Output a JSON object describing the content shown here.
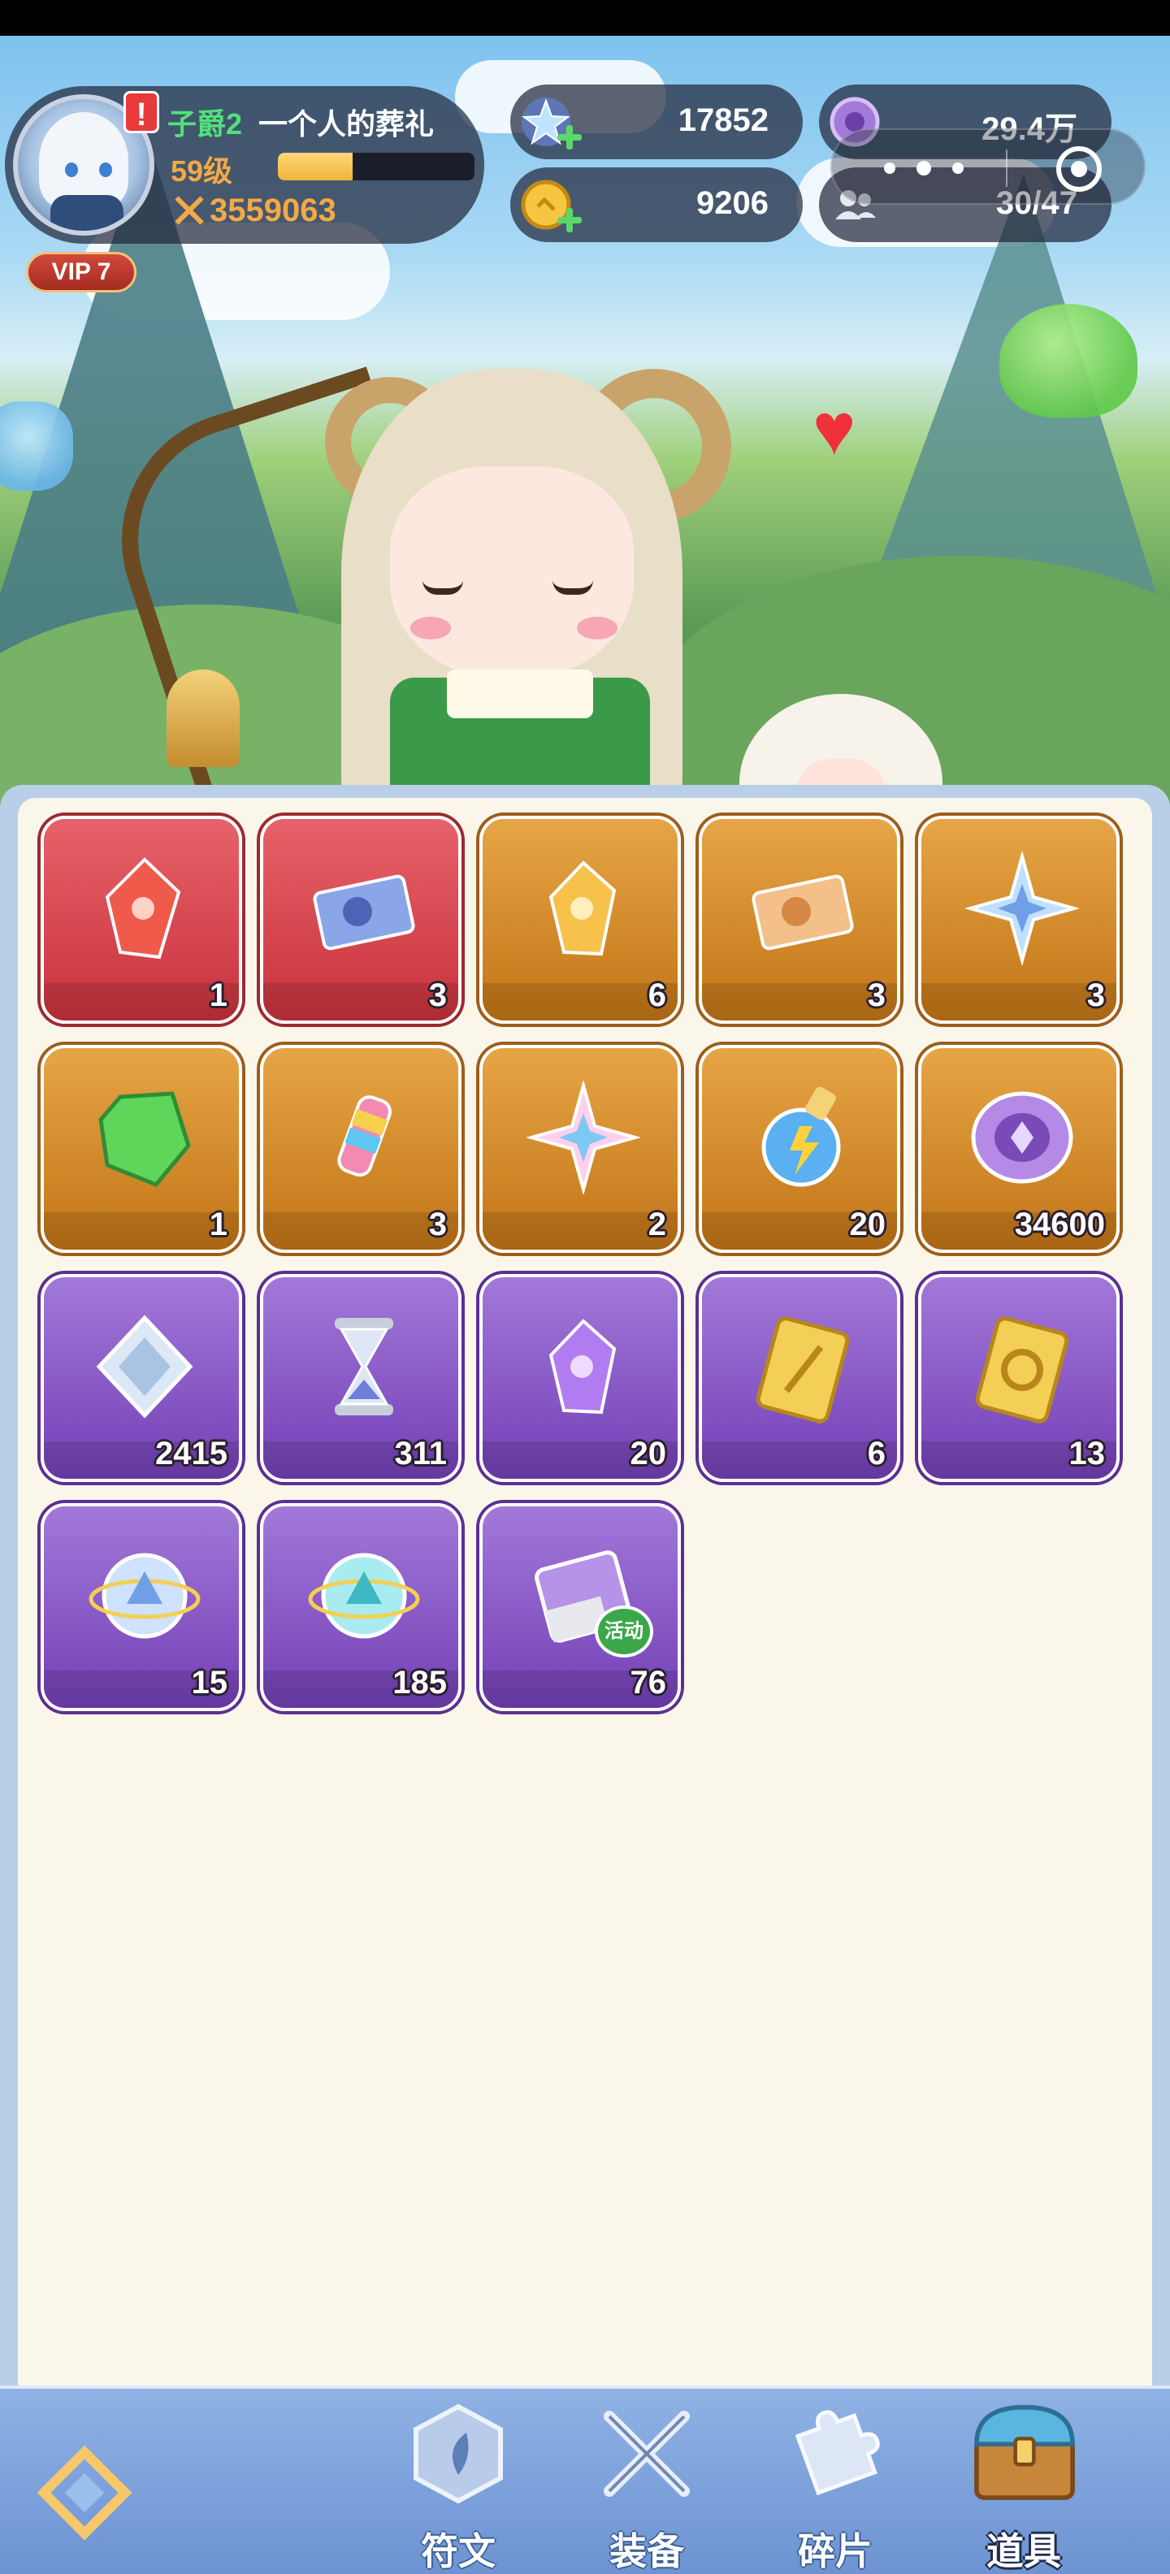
{
  "player": {
    "rank": "子爵2",
    "name": "一个人的葬礼",
    "level": "59级",
    "xp_fraction": 0.38,
    "power": "3559063",
    "vip": "VIP 7",
    "alert": "!"
  },
  "resources": {
    "gems": "17852",
    "gold": "9206",
    "orbs": "29.4万",
    "friends": "30/47"
  },
  "inventory": {
    "items": [
      {
        "name": "red-crystal",
        "count": "1",
        "rarity": "red"
      },
      {
        "name": "blue-ticket",
        "count": "3",
        "rarity": "red"
      },
      {
        "name": "gold-crystal",
        "count": "6",
        "rarity": "gold"
      },
      {
        "name": "orange-ticket",
        "count": "3",
        "rarity": "gold"
      },
      {
        "name": "blue-star",
        "count": "3",
        "rarity": "gold"
      },
      {
        "name": "green-crystal",
        "count": "1",
        "rarity": "gold"
      },
      {
        "name": "rainbow-drill",
        "count": "3",
        "rarity": "gold"
      },
      {
        "name": "prism-star",
        "count": "2",
        "rarity": "gold"
      },
      {
        "name": "lightning-potion",
        "count": "20",
        "rarity": "gold"
      },
      {
        "name": "purple-coin",
        "count": "34600",
        "rarity": "gold"
      },
      {
        "name": "diamond",
        "count": "2415",
        "rarity": "purple"
      },
      {
        "name": "hourglass",
        "count": "311",
        "rarity": "purple"
      },
      {
        "name": "purple-crystal",
        "count": "20",
        "rarity": "purple"
      },
      {
        "name": "sword-card",
        "count": "6",
        "rarity": "purple"
      },
      {
        "name": "refresh-card",
        "count": "13",
        "rarity": "purple"
      },
      {
        "name": "crystal-orb-blue",
        "count": "15",
        "rarity": "purple"
      },
      {
        "name": "crystal-orb-teal",
        "count": "185",
        "rarity": "purple"
      },
      {
        "name": "event-book",
        "count": "76",
        "rarity": "purple",
        "tag": "活动"
      }
    ]
  },
  "nav": {
    "tabs": [
      {
        "label": "符文",
        "icon": "rune-icon"
      },
      {
        "label": "装备",
        "icon": "crossed-swords-icon"
      },
      {
        "label": "碎片",
        "icon": "puzzle-icon"
      },
      {
        "label": "道具",
        "icon": "treasure-chest-icon",
        "active": true
      }
    ]
  },
  "colors": {
    "accent_green": "#54e07a",
    "accent_orange": "#f4a945",
    "slot_red": "#d04048",
    "slot_gold": "#d58b2c",
    "slot_purple": "#8a5ac7",
    "panel": "#fbf6ea"
  }
}
